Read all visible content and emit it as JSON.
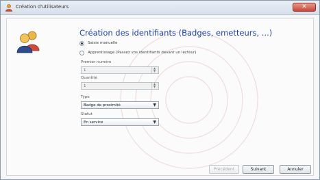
{
  "window": {
    "title": "Création d'utilisateurs",
    "close_glyph": "✕"
  },
  "header": {
    "title": "Création des identifiants (Badges, emetteurs, ...)"
  },
  "mode": {
    "options": [
      {
        "label": "Saisie manuelle",
        "selected": true
      },
      {
        "label": "Apprentissage (Passez vos identifiants devant un lecteur)",
        "selected": false
      }
    ]
  },
  "fields": {
    "first_number": {
      "label": "Premier numéro",
      "value": "1"
    },
    "quantity": {
      "label": "Quantité",
      "value": "1"
    },
    "type": {
      "label": "Type",
      "value": "Badge de proximité"
    },
    "status": {
      "label": "Statut",
      "value": "En service"
    }
  },
  "buttons": {
    "previous": "Précédent",
    "next": "Suivant",
    "cancel": "Annuler"
  },
  "icons": {
    "window": "user-icon",
    "avatar": "users-icon"
  },
  "colors": {
    "heading": "#1f45a3",
    "close": "#c8473a"
  }
}
